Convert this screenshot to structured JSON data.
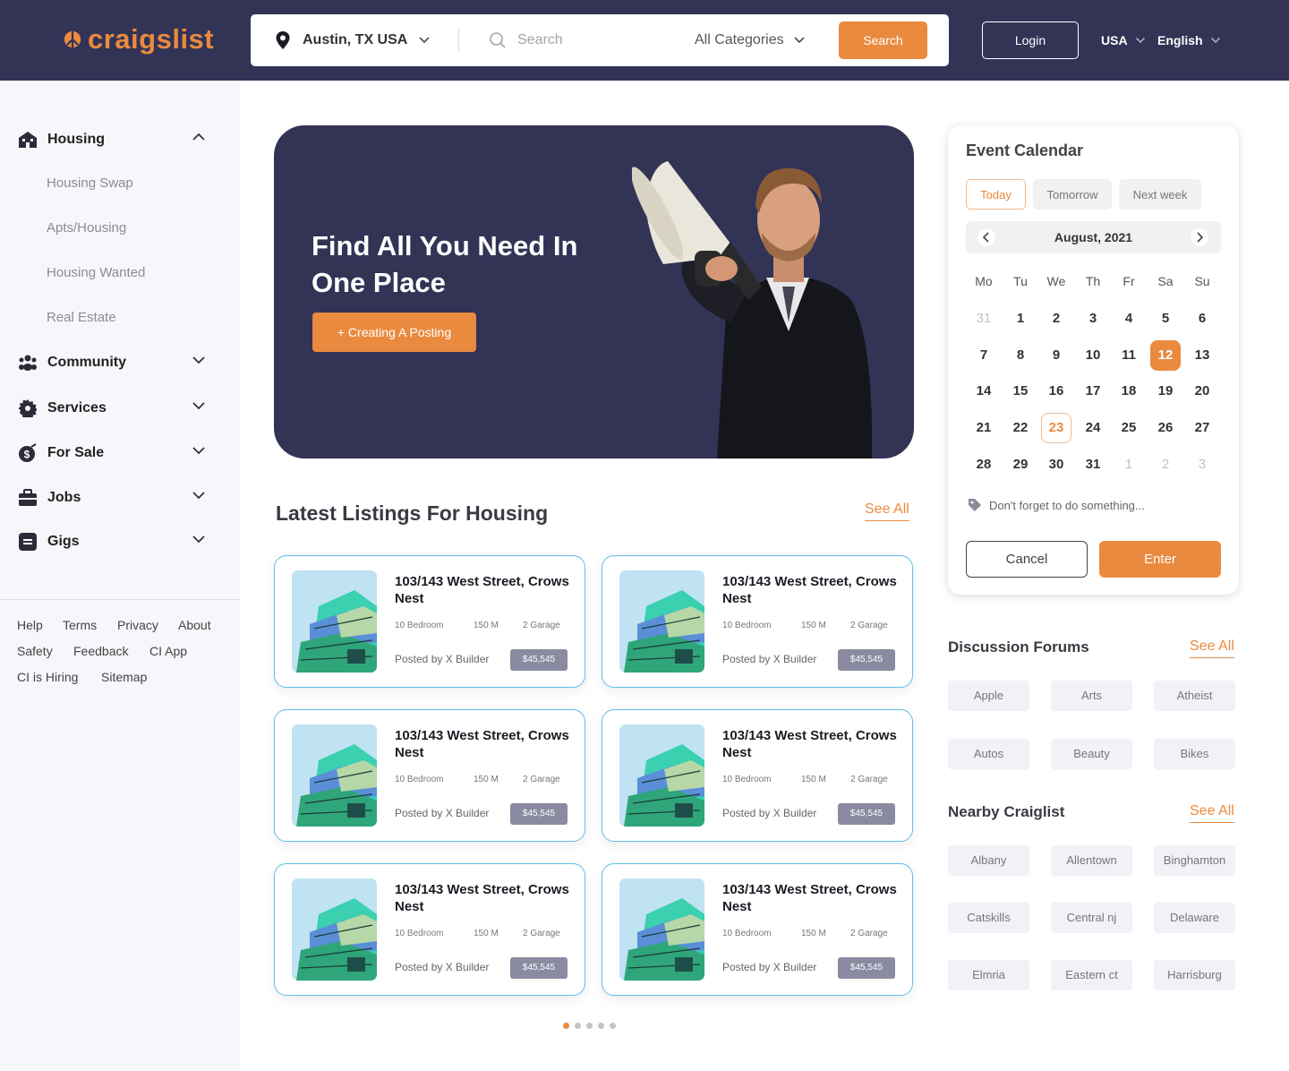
{
  "header": {
    "logo": "craigslist",
    "location": "Austin, TX USA",
    "search_placeholder": "Search",
    "category": "All Categories",
    "search_button": "Search",
    "login": "Login",
    "country": "USA",
    "language": "English"
  },
  "sidebar": {
    "items": [
      {
        "label": "Housing",
        "icon": "house-icon",
        "expanded": true
      },
      {
        "label": "Community",
        "icon": "people-icon"
      },
      {
        "label": "Services",
        "icon": "gear-icon"
      },
      {
        "label": "For Sale",
        "icon": "dollar-icon"
      },
      {
        "label": "Jobs",
        "icon": "briefcase-icon"
      },
      {
        "label": "Gigs",
        "icon": "list-icon"
      }
    ],
    "housing_sub": [
      "Housing Swap",
      "Apts/Housing",
      "Housing Wanted",
      "Real Estate"
    ],
    "footer_links": [
      "Help",
      "Terms",
      "Privacy",
      "About",
      "Safety",
      "Feedback",
      "CI App",
      "CI is Hiring",
      "Sitemap"
    ]
  },
  "hero": {
    "title": "Find All You Need In One Place",
    "button": "+ Creating A Posting"
  },
  "listings": {
    "title": "Latest Listings For Housing",
    "see_all": "See All",
    "cards": [
      {
        "title": "103/143 West Street, Crows Nest",
        "bedroom": "10 Bedroom",
        "size": "150 M",
        "garage": "2 Garage",
        "posted": "Posted by X Builder",
        "price": "$45,545"
      },
      {
        "title": "103/143 West Street, Crows Nest",
        "bedroom": "10 Bedroom",
        "size": "150 M",
        "garage": "2 Garage",
        "posted": "Posted by X Builder",
        "price": "$45,545"
      },
      {
        "title": "103/143 West Street, Crows Nest",
        "bedroom": "10 Bedroom",
        "size": "150 M",
        "garage": "2 Garage",
        "posted": "Posted by X Builder",
        "price": "$45,545"
      },
      {
        "title": "103/143 West Street, Crows Nest",
        "bedroom": "10 Bedroom",
        "size": "150 M",
        "garage": "2 Garage",
        "posted": "Posted by X Builder",
        "price": "$45,545"
      },
      {
        "title": "103/143 West Street, Crows Nest",
        "bedroom": "10 Bedroom",
        "size": "150 M",
        "garage": "2 Garage",
        "posted": "Posted by X Builder",
        "price": "$45,545"
      },
      {
        "title": "103/143 West Street, Crows Nest",
        "bedroom": "10 Bedroom",
        "size": "150 M",
        "garage": "2 Garage",
        "posted": "Posted by X Builder",
        "price": "$45,545"
      }
    ],
    "pagination": {
      "pages": 5,
      "active": 1
    }
  },
  "calendar": {
    "title": "Event Calendar",
    "chips": [
      "Today",
      "Tomorrow",
      "Next week"
    ],
    "active_chip": "Today",
    "month": "August, 2021",
    "weekdays": [
      "Mo",
      "Tu",
      "We",
      "Th",
      "Fr",
      "Sa",
      "Su"
    ],
    "weeks": [
      [
        "31",
        "1",
        "2",
        "3",
        "4",
        "5",
        "6"
      ],
      [
        "7",
        "8",
        "9",
        "10",
        "11",
        "12",
        "13"
      ],
      [
        "14",
        "15",
        "16",
        "17",
        "18",
        "19",
        "20"
      ],
      [
        "21",
        "22",
        "23",
        "24",
        "25",
        "26",
        "27"
      ],
      [
        "28",
        "29",
        "30",
        "31",
        "1",
        "2",
        "3"
      ]
    ],
    "selected_day": "12",
    "marked_day": "23",
    "note": "Don't forget to do something...",
    "cancel": "Cancel",
    "enter": "Enter"
  },
  "forums": {
    "title": "Discussion Forums",
    "see_all": "See All",
    "tags": [
      "Apple",
      "Arts",
      "Atheist",
      "Autos",
      "Beauty",
      "Bikes"
    ]
  },
  "nearby": {
    "title": "Nearby Craiglist",
    "see_all": "See All",
    "tags": [
      "Albany",
      "Allentown",
      "Binghamton",
      "Catskills",
      "Central nj",
      "Delaware",
      "Elmria",
      "Eastern ct",
      "Harrisburg"
    ]
  },
  "colors": {
    "accent": "#e98a3f",
    "navy": "#333356",
    "card_border": "#5ec0e8"
  }
}
